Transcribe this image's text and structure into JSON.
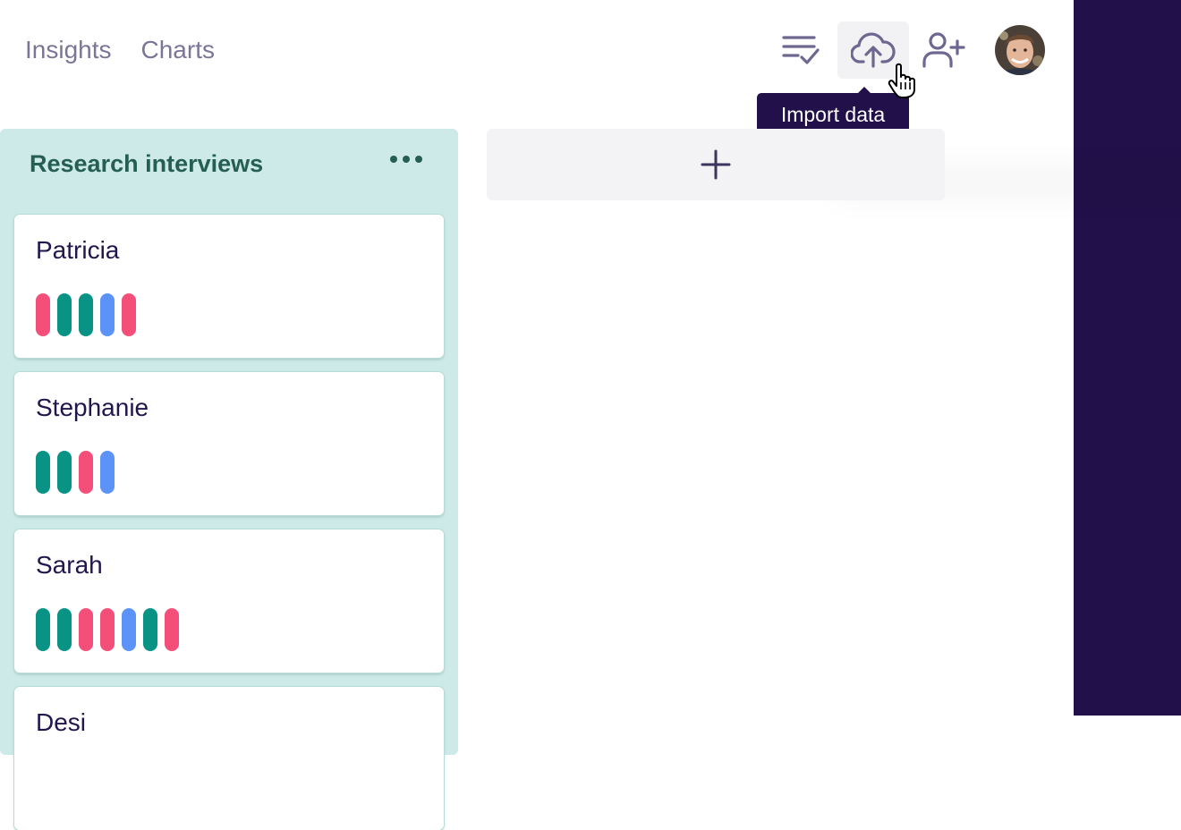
{
  "nav": {
    "insights": "Insights",
    "charts": "Charts"
  },
  "toolbar": {
    "checklist_icon": "checklist-icon",
    "upload_icon": "cloud-upload-icon",
    "add_user_icon": "user-plus-icon",
    "tooltip": "Import data"
  },
  "board": {
    "column_title": "Research interviews",
    "cards": [
      {
        "name": "Patricia",
        "tags": [
          "#f44f78",
          "#089384",
          "#089384",
          "#5b93f8",
          "#f44f78"
        ]
      },
      {
        "name": "Stephanie",
        "tags": [
          "#089384",
          "#089384",
          "#f44f78",
          "#5b93f8"
        ]
      },
      {
        "name": "Sarah",
        "tags": [
          "#089384",
          "#089384",
          "#f44f78",
          "#f44f78",
          "#5b93f8",
          "#089384",
          "#f44f78"
        ]
      },
      {
        "name": "Desi",
        "tags": []
      }
    ]
  },
  "colors": {
    "accent": "#22104a",
    "column_bg": "#cdeae8",
    "pink": "#f44f78",
    "teal": "#089384",
    "blue": "#5b93f8"
  }
}
